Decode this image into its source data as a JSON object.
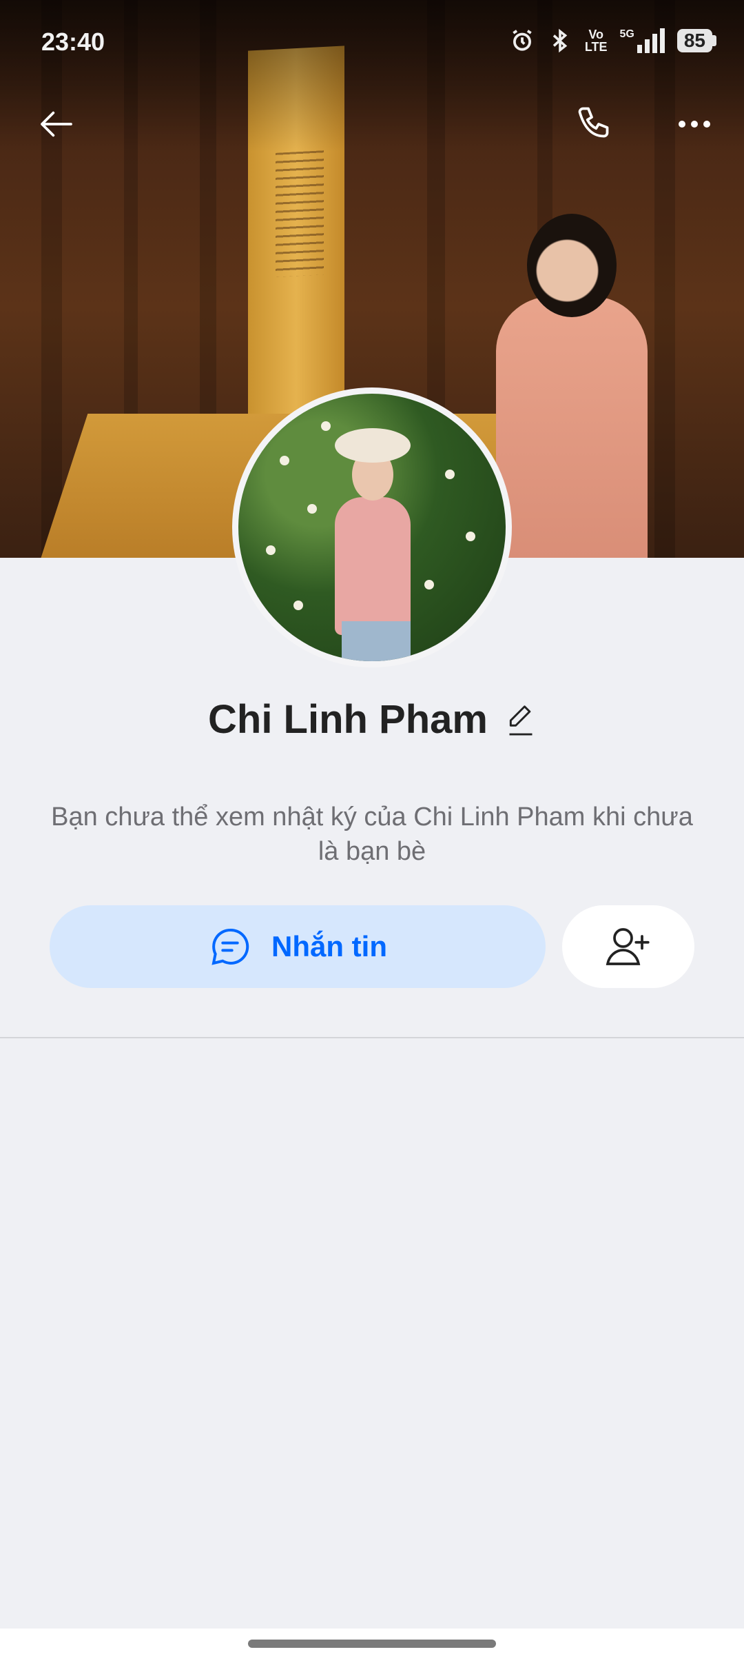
{
  "status_bar": {
    "time": "23:40",
    "volte_top": "Vo",
    "volte_bottom": "LTE",
    "network": "5G",
    "battery": "85",
    "icons": [
      "alarm-icon",
      "bluetooth-icon",
      "volte-icon",
      "signal-icon",
      "battery-icon"
    ]
  },
  "nav": {
    "back_icon": "arrow-left-icon",
    "call_icon": "phone-icon",
    "more_icon": "more-dots-icon"
  },
  "profile": {
    "name": "Chi Linh Pham",
    "edit_icon": "pencil-icon",
    "notice": "Bạn chưa thể xem nhật ký của Chi Linh Pham khi chưa là bạn bè"
  },
  "actions": {
    "message_label": "Nhắn tin",
    "message_icon": "chat-bubble-icon",
    "add_friend_icon": "add-friend-icon"
  },
  "colors": {
    "accent": "#0068ff",
    "message_button_bg": "#d6e7fd",
    "page_bg": "#eff0f4"
  }
}
